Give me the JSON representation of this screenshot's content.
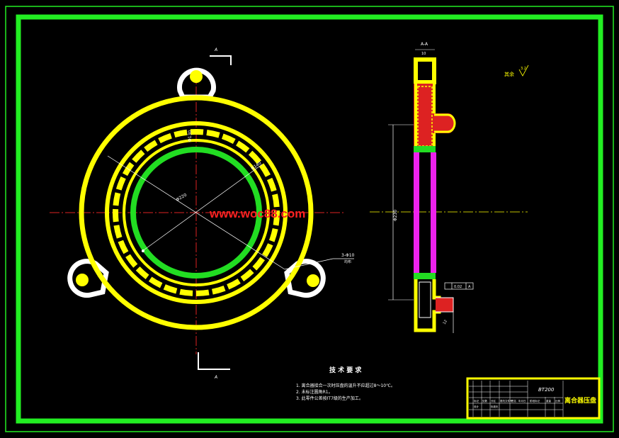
{
  "colors": {
    "background": "#000000",
    "frame": "#22ee22",
    "part_outline": "#ffff00",
    "inner_ring": "#22dd22",
    "lugs": "#ffffff",
    "section_web": "#ee22ee",
    "section_hatch": "#dd2222",
    "watermark": "#ff2222"
  },
  "front_view": {
    "section_mark_top": "A",
    "section_mark_bottom": "A",
    "dim_inner": "Φ130",
    "dim_outer": "Φ220",
    "dim_mid": "Φ140",
    "dim_holes": "3-Φ10",
    "dim_holes_sub": "均布"
  },
  "section_view": {
    "section_label": "A-A",
    "dim_top": "10",
    "dim_height": "Φ230",
    "tol_frame": "0.02",
    "tol_ref": "A",
    "dim_lower": "12"
  },
  "surface_note": {
    "label": "其余",
    "value": "3.2"
  },
  "watermark": "www.woc88.com",
  "tech_requirements": {
    "title": "技 术 要 求",
    "items": [
      "1. 离合器接合一次时压盘的温升不应超过8～10℃。",
      "2. 未标注圆角R1。",
      "3. 此零件公差按IT7级的生产加工。"
    ]
  },
  "title_block": {
    "code": "BT200",
    "name": "离合器压盘",
    "cells": [
      "标记",
      "处数",
      "分区",
      "更改文件号",
      "签名",
      "年月日",
      "设计",
      "标准化",
      "阶段标记",
      "重量",
      "比例"
    ]
  }
}
